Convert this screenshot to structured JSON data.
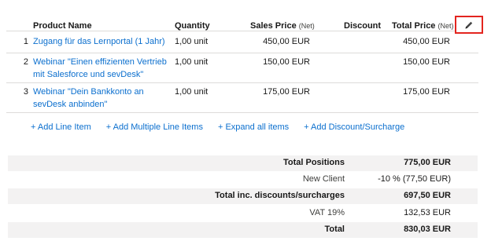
{
  "header": {
    "product_name": "Product Name",
    "quantity": "Quantity",
    "sales_price": "Sales Price",
    "sales_price_net": "(Net)",
    "discount": "Discount",
    "total_price": "Total Price",
    "total_price_net": "(Net)"
  },
  "icons": {
    "edit": "pencil-icon"
  },
  "items": [
    {
      "no": "1",
      "product_line1": "Zugang für das Lernportal (1 Jahr)",
      "product_line2": "",
      "quantity": "1,00 unit",
      "sales_price": "450,00 EUR",
      "discount": "",
      "total": "450,00 EUR"
    },
    {
      "no": "2",
      "product_line1": "Webinar \"Einen effizienten Vertrieb",
      "product_line2": "mit Salesforce und sevDesk\"",
      "quantity": "1,00 unit",
      "sales_price": "150,00 EUR",
      "discount": "",
      "total": "150,00 EUR"
    },
    {
      "no": "3",
      "product_line1": "Webinar \"Dein Bankkonto an",
      "product_line2": "sevDesk anbinden\"",
      "quantity": "1,00 unit",
      "sales_price": "175,00 EUR",
      "discount": "",
      "total": "175,00 EUR"
    }
  ],
  "actions": {
    "add_line_item": "+ Add Line Item",
    "add_multiple": "+ Add Multiple Line Items",
    "expand_all": "+ Expand all items",
    "add_discount": "+ Add Discount/Surcharge"
  },
  "summary": {
    "total_positions_label": "Total Positions",
    "total_positions_value": "775,00 EUR",
    "new_client_label": "New Client",
    "new_client_value": "-10 % (77,50 EUR)",
    "total_inc_label": "Total inc. discounts/surcharges",
    "total_inc_value": "697,50 EUR",
    "vat_label": "VAT 19%",
    "vat_value": "132,53 EUR",
    "total_label": "Total",
    "total_value": "830,03 EUR"
  },
  "colors": {
    "link": "#0b6fce",
    "highlight_border": "#e3251f",
    "summary_bg": "#f3f2f2",
    "divider": "#dddbda"
  }
}
